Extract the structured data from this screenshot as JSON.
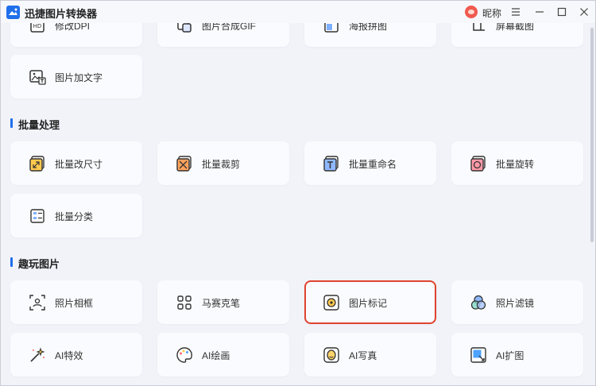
{
  "app": {
    "title": "迅捷图片转换器",
    "user_name": "昵称",
    "accent": "#1f6feb",
    "highlight": "#e0432f"
  },
  "top_row": [
    {
      "label": "修改DPI",
      "icon": "dpi-icon"
    },
    {
      "label": "图片合成GIF",
      "icon": "gif-icon"
    },
    {
      "label": "海报拼图",
      "icon": "poster-collage-icon"
    },
    {
      "label": "屏幕截图",
      "icon": "screenshot-icon"
    }
  ],
  "misc": [
    {
      "label": "图片加文字",
      "icon": "add-text-icon"
    }
  ],
  "sections": [
    {
      "title": "批量处理",
      "items": [
        {
          "label": "批量改尺寸",
          "icon": "batch-resize-icon"
        },
        {
          "label": "批量裁剪",
          "icon": "batch-crop-icon"
        },
        {
          "label": "批量重命名",
          "icon": "batch-rename-icon"
        },
        {
          "label": "批量旋转",
          "icon": "batch-rotate-icon"
        },
        {
          "label": "批量分类",
          "icon": "batch-classify-icon"
        }
      ]
    },
    {
      "title": "趣玩图片",
      "items": [
        {
          "label": "照片相框",
          "icon": "photo-frame-icon"
        },
        {
          "label": "马赛克笔",
          "icon": "mosaic-pen-icon"
        },
        {
          "label": "图片标记",
          "icon": "image-mark-icon"
        },
        {
          "label": "照片滤镜",
          "icon": "photo-filter-icon"
        },
        {
          "label": "AI特效",
          "icon": "ai-effect-icon"
        },
        {
          "label": "AI绘画",
          "icon": "ai-painting-icon"
        },
        {
          "label": "AI写真",
          "icon": "ai-portrait-icon"
        },
        {
          "label": "AI扩图",
          "icon": "ai-expand-icon"
        }
      ]
    }
  ]
}
